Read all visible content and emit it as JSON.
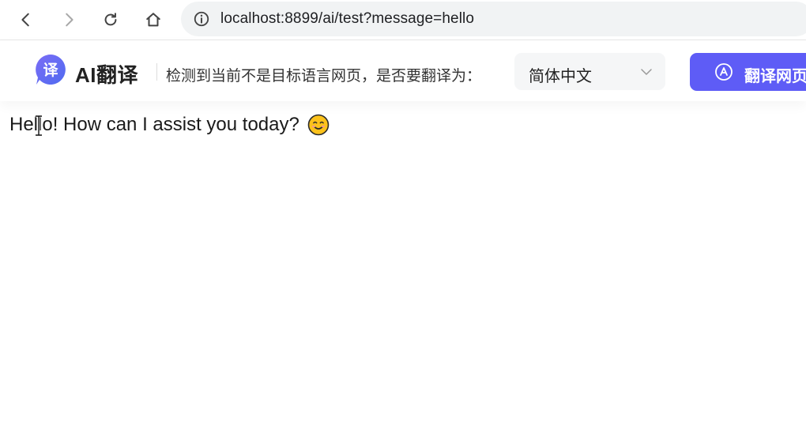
{
  "browser": {
    "url": "localhost:8899/ai/test?message=hello",
    "icons": [
      "back-icon",
      "forward-icon",
      "reload-icon",
      "home-icon",
      "info-icon"
    ]
  },
  "translate_bar": {
    "brand_logo_char": "译",
    "brand_name": "AI翻译",
    "prompt": "检测到当前不是目标语言网页，是否要翻译为：",
    "target_language": "简体中文",
    "translate_button": "翻译网页",
    "accent_color": "#5e5cf6"
  },
  "page": {
    "message": "Hello! How can I assist you today?",
    "emoji": "smiling-face-emoji"
  }
}
